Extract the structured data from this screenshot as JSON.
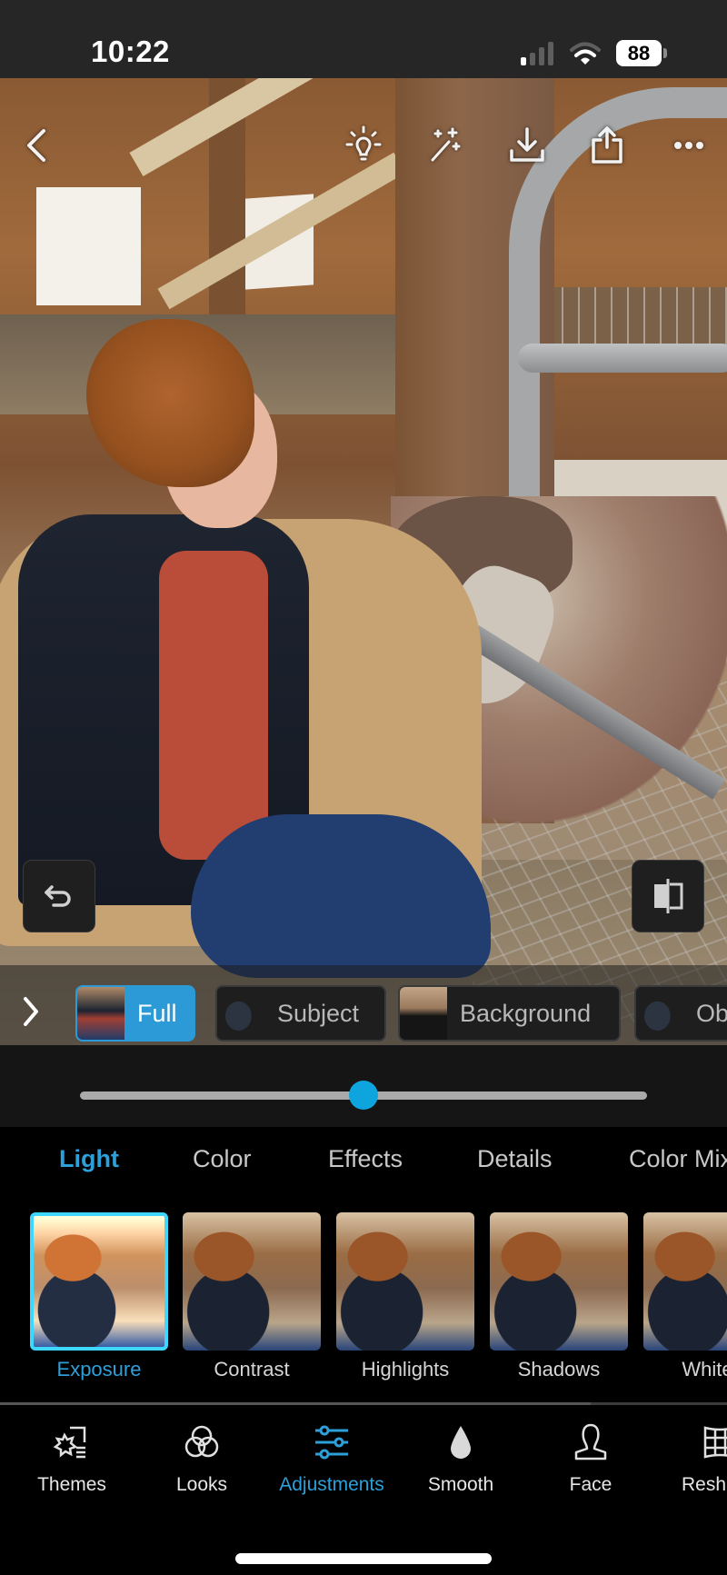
{
  "status_bar": {
    "time": "10:22",
    "signal_bars_active": 1,
    "signal_bars_total": 4,
    "battery": "88"
  },
  "toolbar": {
    "icons": [
      "chevron-left-icon",
      "lightbulb-icon",
      "magic-wand-icon",
      "download-icon",
      "share-icon",
      "more-icon"
    ]
  },
  "photo": {
    "description": "Young man with curly red hair and glasses petting a goat in a barn"
  },
  "masks": {
    "items": [
      {
        "label": "Full",
        "active": true
      },
      {
        "label": "Subject",
        "active": false
      },
      {
        "label": "Background",
        "active": false
      },
      {
        "label": "Ob",
        "active": false
      }
    ]
  },
  "slider": {
    "value_fraction": 0.5
  },
  "categories": {
    "tabs": [
      {
        "label": "Light",
        "active": true
      },
      {
        "label": "Color",
        "active": false
      },
      {
        "label": "Effects",
        "active": false
      },
      {
        "label": "Details",
        "active": false
      },
      {
        "label": "Color Mix",
        "active": false
      }
    ]
  },
  "adjustments": {
    "items": [
      {
        "label": "Exposure",
        "active": true
      },
      {
        "label": "Contrast",
        "active": false
      },
      {
        "label": "Highlights",
        "active": false
      },
      {
        "label": "Shadows",
        "active": false
      },
      {
        "label": "Whites",
        "active": false
      }
    ]
  },
  "bottom_nav": {
    "items": [
      {
        "label": "Themes",
        "icon": "themes-icon",
        "active": false
      },
      {
        "label": "Looks",
        "icon": "looks-icon",
        "active": false
      },
      {
        "label": "Adjustments",
        "icon": "adjustments-icon",
        "active": true
      },
      {
        "label": "Smooth",
        "icon": "smooth-drop-icon",
        "active": false
      },
      {
        "label": "Face",
        "icon": "face-icon",
        "active": false
      },
      {
        "label": "Reshape",
        "icon": "reshape-icon",
        "active": false
      }
    ]
  },
  "colors": {
    "accent": "#2d9fd9",
    "slider_thumb": "#0ea5de",
    "status_bar_bg": "#262626",
    "panel_bg": "#000000"
  }
}
